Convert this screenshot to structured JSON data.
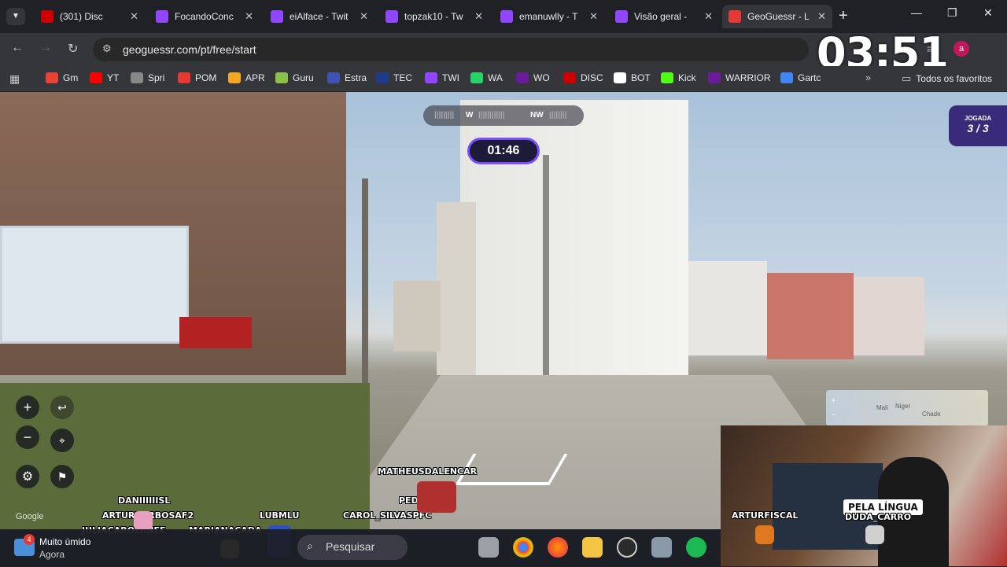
{
  "tabs": [
    {
      "title": "(301) Disc",
      "icon": "youtube-icon",
      "color": "#cc0000",
      "extra": "◉"
    },
    {
      "title": "FocandoConc",
      "icon": "twitch-icon",
      "color": "#9146ff"
    },
    {
      "title": "eiAlface - Twit",
      "icon": "twitch-icon",
      "color": "#9146ff"
    },
    {
      "title": "topzak10 - Tw",
      "icon": "twitch-icon",
      "color": "#9146ff"
    },
    {
      "title": "emanuwlly - T",
      "icon": "twitch-icon",
      "color": "#9146ff"
    },
    {
      "title": "Visão geral - ",
      "icon": "twitch-icon",
      "color": "#9146ff"
    },
    {
      "title": "GeoGuessr - L",
      "icon": "location-pin-icon",
      "color": "#e53935"
    }
  ],
  "address": {
    "url": "geoguessr.com/pt/free/start"
  },
  "overlay_clock": "03:51",
  "profile_initial": "a",
  "bookmarks": [
    {
      "label": "Gm",
      "icon": "gmail-icon",
      "color": "#ea4335"
    },
    {
      "label": "YT",
      "icon": "youtube-icon",
      "color": "#ff0000"
    },
    {
      "label": "Spri",
      "icon": "globe-icon",
      "color": "#888888"
    },
    {
      "label": "POM",
      "icon": "check-icon",
      "color": "#e53935"
    },
    {
      "label": "APR",
      "icon": "runner-icon",
      "color": "#f5a623"
    },
    {
      "label": "Guru",
      "icon": "guru-icon",
      "color": "#8bc34a"
    },
    {
      "label": "Estra",
      "icon": "estra-icon",
      "color": "#3f51b5"
    },
    {
      "label": "TEC",
      "icon": "tec-icon",
      "color": "#1e3a8a"
    },
    {
      "label": "TWI",
      "icon": "twitch-icon",
      "color": "#9146ff"
    },
    {
      "label": "WA",
      "icon": "whatsapp-icon",
      "color": "#25d366"
    },
    {
      "label": "WO",
      "icon": "wo-icon",
      "color": "#6a1b9a"
    },
    {
      "label": "DISC",
      "icon": "discord-icon",
      "color": "#cc0000"
    },
    {
      "label": "BOT",
      "icon": "bot-icon",
      "color": "#ffffff"
    },
    {
      "label": "Kick",
      "icon": "kick-icon",
      "color": "#53fc18"
    },
    {
      "label": "WARRIOR",
      "icon": "warrior-icon",
      "color": "#6a1b9a"
    },
    {
      "label": "Gartc",
      "icon": "google-icon",
      "color": "#4285f4"
    }
  ],
  "all_bookmarks": "Todos os favoritos",
  "game": {
    "compass": [
      "W",
      "NW"
    ],
    "timer": "01:46",
    "round_label": "JOGADA",
    "round_value": "3 / 3",
    "map_labels": [
      "Mali",
      "Niger",
      "Chade"
    ],
    "google": "Google"
  },
  "stream": {
    "caption": "PELA LÍNGUA",
    "viewers": [
      "MATHEUSDALENCAR",
      "PEDROHGT",
      "DANIIIIIISL",
      "ARTURBARBOSAF2",
      "JULIACAROLIINEE",
      "MARIANACADA",
      "LUBMLU",
      "CAROL_SILVASPFC",
      "ARTURFISCAL",
      "DUDA_CARRO"
    ]
  },
  "taskbar": {
    "weather_title": "Muito úmido",
    "weather_sub": "Agora",
    "weather_badge": "4",
    "search_placeholder": "Pesquisar"
  }
}
